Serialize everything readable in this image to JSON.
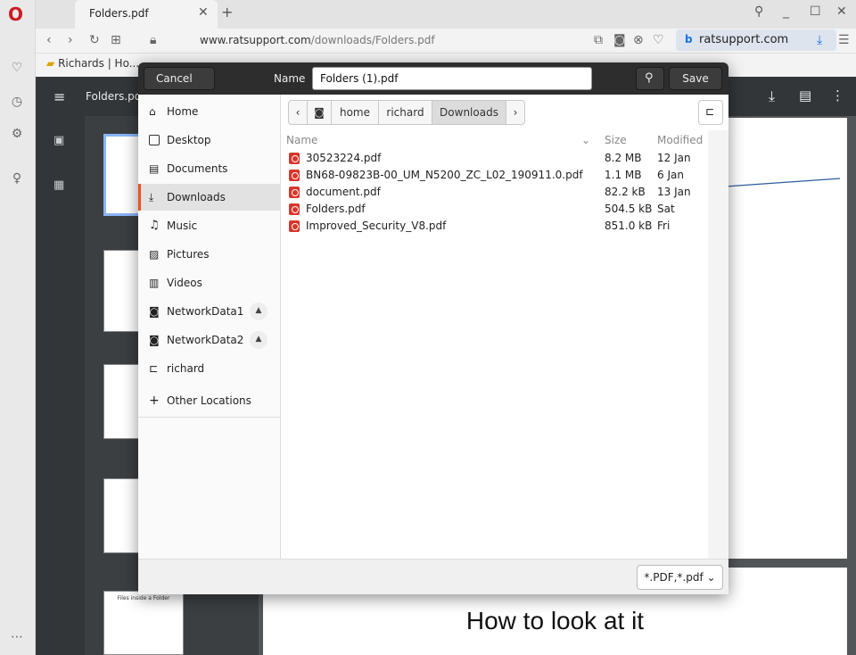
{
  "browser": {
    "tab_title": "Folders.pdf",
    "url_host": "www.ratsupport.com",
    "url_path": "/downloads/Folders.pdf",
    "site_button": "ratsupport.com",
    "bookmark": "Richards | Ho...",
    "logo": "O"
  },
  "pdf": {
    "title": "Folders.pdf",
    "page2_heading": "How to look at it",
    "thumb_caption": "Files inside a Folder"
  },
  "dialog": {
    "cancel_label": "Cancel",
    "name_label": "Name",
    "name_value": "Folders (1).pdf",
    "save_label": "Save",
    "places": [
      {
        "label": "Home",
        "icon": "home-icon"
      },
      {
        "label": "Desktop",
        "icon": "desktop-icon"
      },
      {
        "label": "Documents",
        "icon": "documents-icon"
      },
      {
        "label": "Downloads",
        "icon": "downloads-icon"
      },
      {
        "label": "Music",
        "icon": "music-icon"
      },
      {
        "label": "Pictures",
        "icon": "pictures-icon"
      },
      {
        "label": "Videos",
        "icon": "videos-icon"
      },
      {
        "label": "NetworkData1",
        "icon": "drive-icon"
      },
      {
        "label": "NetworkData2",
        "icon": "drive-icon"
      },
      {
        "label": "richard",
        "icon": "folder-icon"
      },
      {
        "label": "Other Locations",
        "icon": "plus-icon"
      }
    ],
    "breadcrumbs": [
      "home",
      "richard",
      "Downloads"
    ],
    "columns": {
      "name": "Name",
      "size": "Size",
      "modified": "Modified"
    },
    "files": [
      {
        "name": "30523224.pdf",
        "size": "8.2 MB",
        "modified": "12 Jan"
      },
      {
        "name": "BN68-09823B-00_UM_N5200_ZC_L02_190911.0.pdf",
        "size": "1.1 MB",
        "modified": "6 Jan"
      },
      {
        "name": "document.pdf",
        "size": "82.2 kB",
        "modified": "13 Jan"
      },
      {
        "name": "Folders.pdf",
        "size": "504.5 kB",
        "modified": "Sat"
      },
      {
        "name": "Improved_Security_V8.pdf",
        "size": "851.0 kB",
        "modified": "Fri"
      }
    ],
    "filter": "*.PDF,*.pdf"
  },
  "colors": {
    "accent": "#e95420",
    "pdf_icon": "#d9362b",
    "arrow": "#2c5aa0",
    "opera": "#cc1b24"
  }
}
